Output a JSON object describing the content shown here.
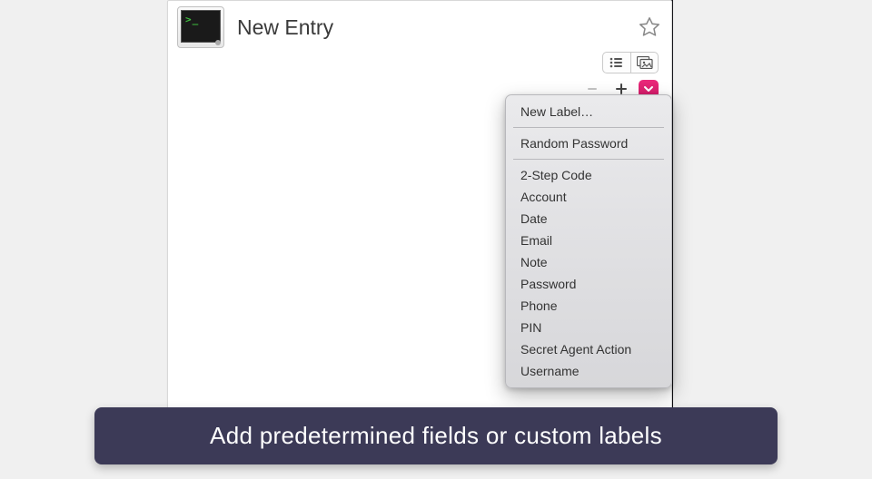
{
  "title": "New Entry",
  "icon_name": "terminal-app-icon",
  "colors": {
    "accent": "#e02276",
    "caption_bg": "#3c3a57"
  },
  "add_menu": {
    "group1": [
      "New Label…"
    ],
    "group2": [
      "Random Password"
    ],
    "group3": [
      "2-Step Code",
      "Account",
      "Date",
      "Email",
      "Note",
      "Password",
      "Phone",
      "PIN",
      "Secret Agent Action",
      "Username"
    ]
  },
  "caption": "Add predetermined fields or custom labels"
}
